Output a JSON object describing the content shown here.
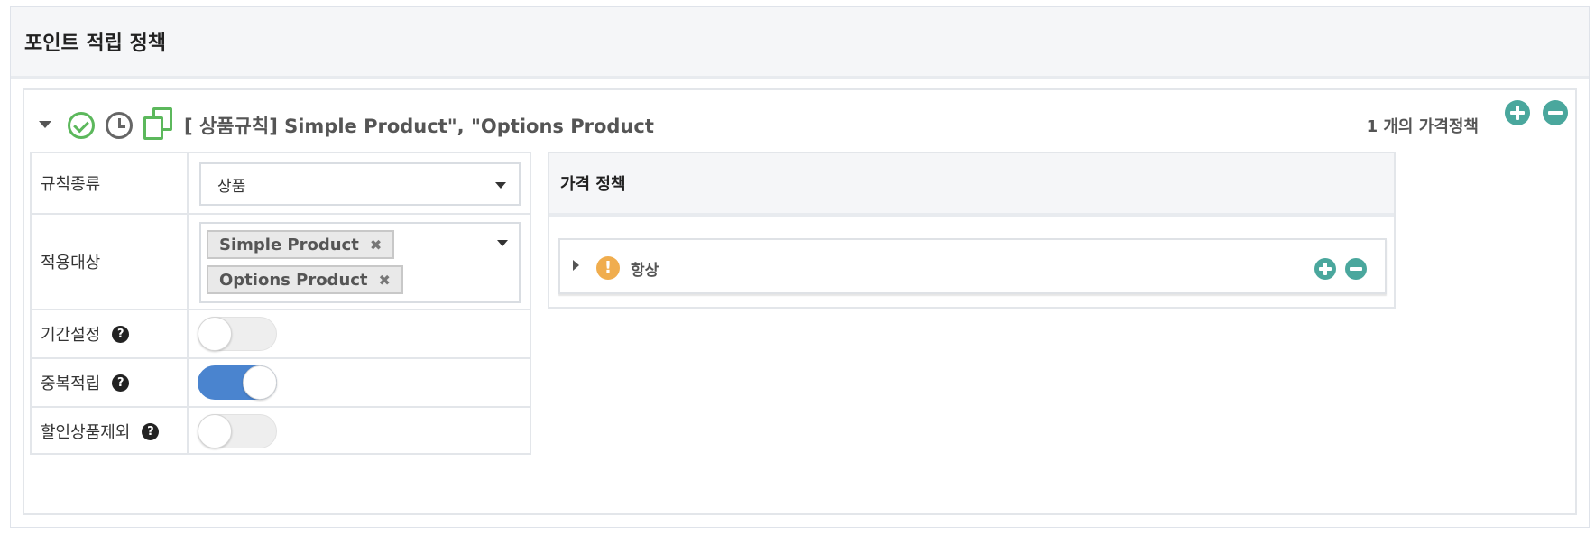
{
  "page": {
    "title": "포인트 적립 정책"
  },
  "rule": {
    "title": "[ 상품규칙] Simple Product\", \"Options Product",
    "price_count": "1 개의 가격정책",
    "icons": [
      "caret-down-icon",
      "check-circle-icon",
      "clock-icon",
      "copy-icon",
      "plus-circle-icon",
      "minus-circle-icon"
    ]
  },
  "settings": {
    "rule_type": {
      "label": "규칙종류",
      "value": "상품"
    },
    "target": {
      "label": "적용대상",
      "tags": [
        "Simple Product",
        "Options Product"
      ],
      "remove_symbol": "✖"
    },
    "period": {
      "label": "기간설정",
      "enabled": false
    },
    "duplicate": {
      "label": "중복적립",
      "enabled": true
    },
    "exclude_discount": {
      "label": "할인상품제외",
      "enabled": false
    },
    "help_symbol": "?"
  },
  "price_policy": {
    "title": "가격 정책",
    "items": [
      {
        "label": "항상",
        "icon": "warning-icon",
        "symbol": "!"
      }
    ]
  },
  "colors": {
    "accent_teal": "#4aa79d",
    "toggle_on": "#4a84cf",
    "check_green": "#5cb85c",
    "warning": "#f0ad4e"
  }
}
